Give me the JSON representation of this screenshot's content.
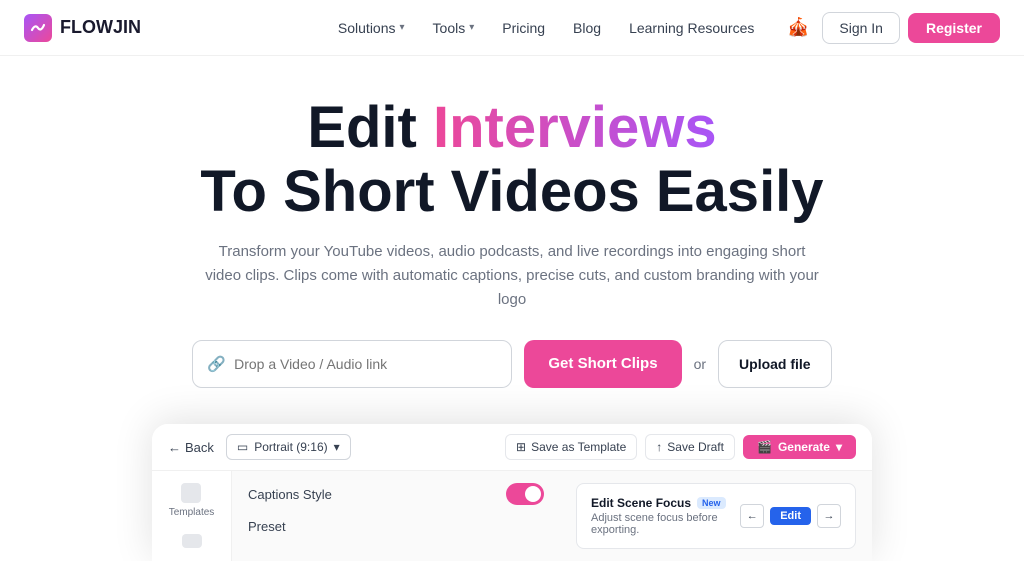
{
  "brand": {
    "name": "FLOWJIN",
    "logo_icon": "~"
  },
  "nav": {
    "solutions_label": "Solutions",
    "tools_label": "Tools",
    "pricing_label": "Pricing",
    "blog_label": "Blog",
    "learning_label": "Learning Resources",
    "signin_label": "Sign In",
    "register_label": "Register"
  },
  "hero": {
    "line1_plain": "Edit ",
    "line1_gradient": "Interviews",
    "line2": "To Short Videos Easily",
    "subtitle": "Transform your YouTube videos, audio podcasts, and live recordings into engaging short video clips. Clips come with automatic captions, precise cuts, and custom branding with your logo"
  },
  "input": {
    "placeholder": "Drop a Video / Audio link",
    "cta_label": "Get Short Clips",
    "or_text": "or",
    "upload_label": "Upload file"
  },
  "preview": {
    "back_label": "Back",
    "orientation_label": "Portrait (9:16)",
    "save_template_label": "Save as Template",
    "save_draft_label": "Save Draft",
    "generate_label": "Generate",
    "sidebar_item1": "Templates",
    "captions_label": "Captions Style",
    "preset_label": "Preset",
    "scene_focus_title": "Edit Scene Focus",
    "scene_focus_badge": "New",
    "scene_focus_desc": "Adjust scene focus before exporting.",
    "edit_label": "Edit"
  }
}
